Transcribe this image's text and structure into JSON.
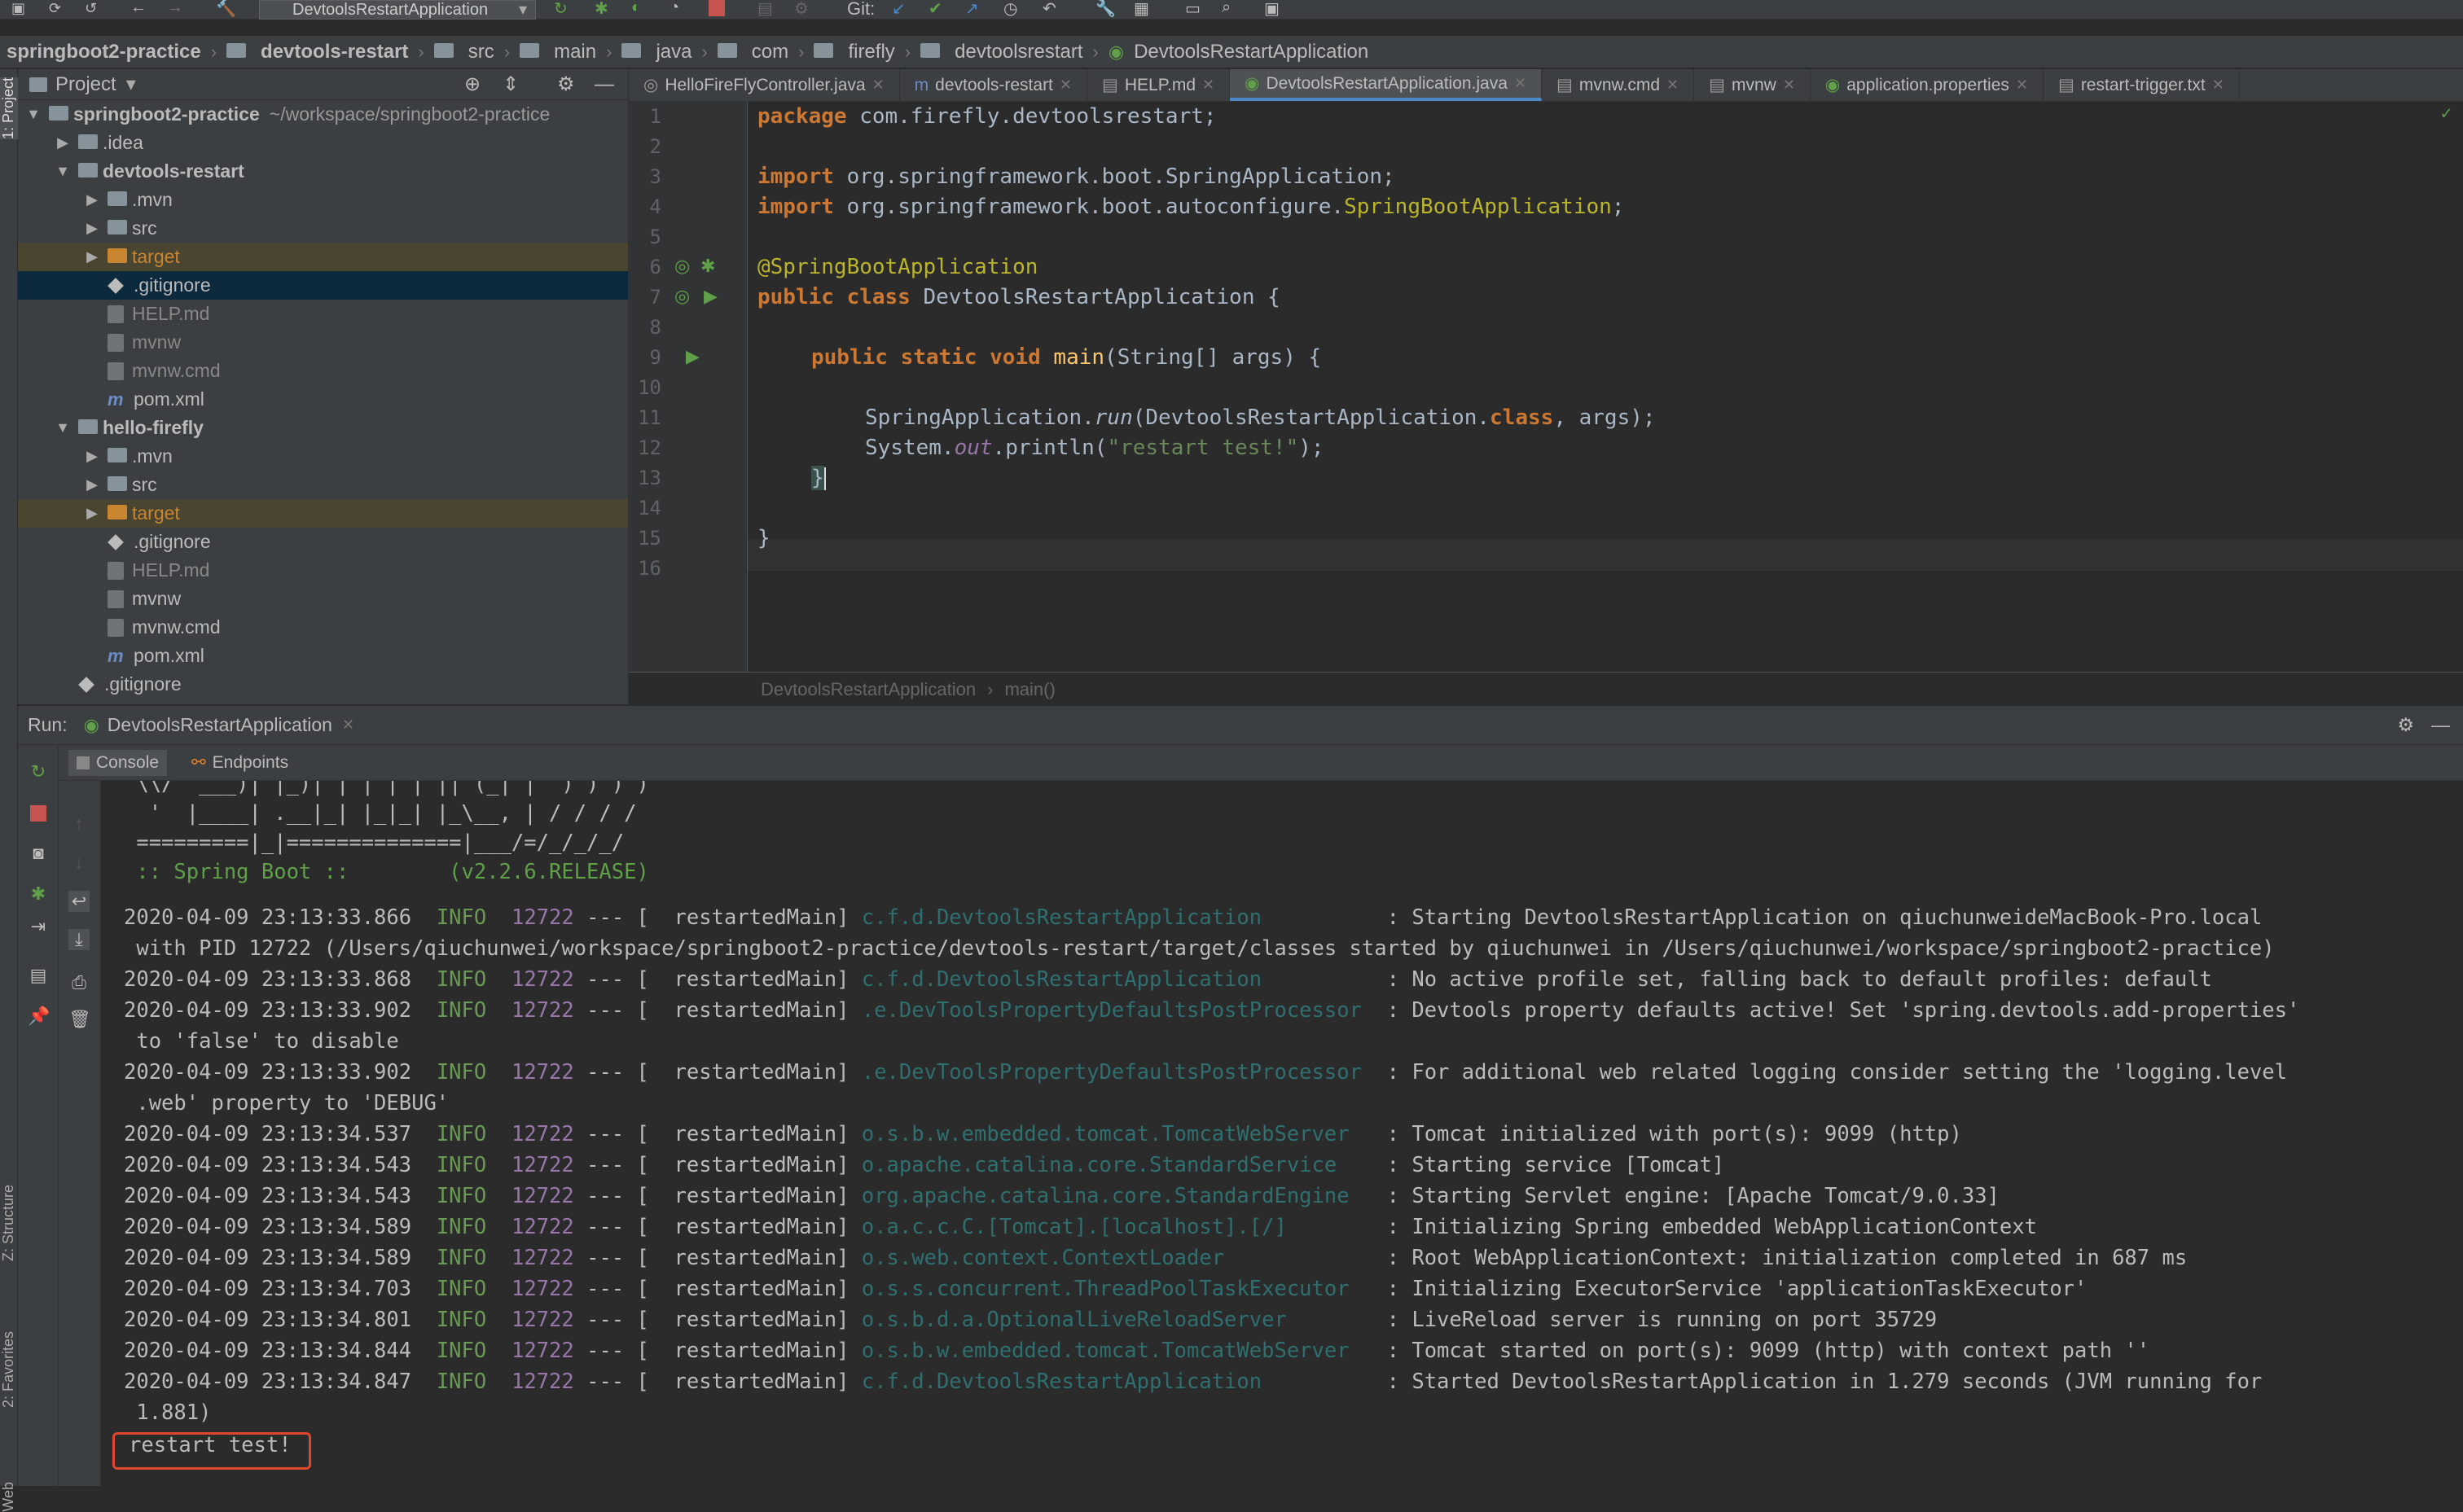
{
  "toolbar": {
    "run_config": "DevtoolsRestartApplication",
    "git_label": "Git:"
  },
  "breadcrumbs": [
    "springboot2-practice",
    "devtools-restart",
    "src",
    "main",
    "java",
    "com",
    "firefly",
    "devtoolsrestart",
    "DevtoolsRestartApplication"
  ],
  "left_strip": {
    "project_tab": "1: Project",
    "structure_tab": "Z: Structure",
    "favorites_tab": "2: Favorites",
    "web_tab": "Web"
  },
  "project": {
    "title": "Project",
    "root_name": "springboot2-practice",
    "root_path": "~/workspace/springboot2-practice",
    "items": [
      {
        "label": ".idea",
        "type": "folder"
      },
      {
        "label": "devtools-restart",
        "type": "folder"
      },
      {
        "label": ".mvn",
        "type": "folder"
      },
      {
        "label": "src",
        "type": "folder"
      },
      {
        "label": "target",
        "type": "folder-orange"
      },
      {
        "label": ".gitignore",
        "type": "git"
      },
      {
        "label": "HELP.md",
        "type": "file"
      },
      {
        "label": "mvnw",
        "type": "file"
      },
      {
        "label": "mvnw.cmd",
        "type": "file"
      },
      {
        "label": "pom.xml",
        "type": "maven"
      },
      {
        "label": "hello-firefly",
        "type": "folder"
      },
      {
        "label": ".mvn",
        "type": "folder"
      },
      {
        "label": "src",
        "type": "folder"
      },
      {
        "label": "target",
        "type": "folder-orange"
      },
      {
        "label": ".gitignore",
        "type": "git"
      },
      {
        "label": "HELP.md",
        "type": "file"
      },
      {
        "label": "mvnw",
        "type": "file"
      },
      {
        "label": "mvnw.cmd",
        "type": "file"
      },
      {
        "label": "pom.xml",
        "type": "maven"
      },
      {
        "label": ".gitignore",
        "type": "git"
      }
    ]
  },
  "editor_tabs": [
    "HelloFireFlyController.java",
    "devtools-restart",
    "HELP.md",
    "DevtoolsRestartApplication.java",
    "mvnw.cmd",
    "mvnw",
    "application.properties",
    "restart-trigger.txt"
  ],
  "code": {
    "line_numbers": [
      "1",
      "2",
      "3",
      "4",
      "5",
      "6",
      "7",
      "8",
      "9",
      "10",
      "11",
      "12",
      "13",
      "14",
      "15",
      "16"
    ],
    "l1_kw": "package",
    "l1_rest": " com.firefly.devtoolsrestart;",
    "l3_kw": "import",
    "l3_rest": " org.springframework.boot.SpringApplication;",
    "l4_kw": "import",
    "l4_pkg": " org.springframework.boot.autoconfigure.",
    "l4_cls": "SpringBootApplication",
    "l4_end": ";",
    "l6_ann": "@SpringBootApplication",
    "l7_kw": "public class",
    "l7_name": " DevtoolsRestartApplication",
    "l7_end": " {",
    "l9_kw": "public static void",
    "l9_mth": " main",
    "l9_args": "(String[] args) {",
    "l11_a": "SpringApplication.",
    "l11_run": "run",
    "l11_b": "(DevtoolsRestartApplication.",
    "l11_cls": "class",
    "l11_c": ", args);",
    "l12_a": "System.",
    "l12_out": "out",
    "l12_b": ".println(",
    "l12_str": "\"restart test!\"",
    "l12_c": ");",
    "l13": "}",
    "l15": "}"
  },
  "editor_breadcrumb": [
    "DevtoolsRestartApplication",
    "main()"
  ],
  "run": {
    "label": "Run:",
    "config": "DevtoolsRestartApplication",
    "tabs": [
      "Console",
      "Endpoints"
    ]
  },
  "console": {
    "banner": [
      " \\\\/  ___)| |_)| | | | | || (_| |  ) ) ) )",
      "  '  |____| .__|_| |_|_| |_\\__, | / / / /",
      " =========|_|==============|___/=/_/_/_/",
      " :: Spring Boot ::        (v2.2.6.RELEASE)"
    ],
    "logs": [
      {
        "ts": "2020-04-09 23:13:33.866",
        "lvl": "INFO",
        "pid": "12722",
        "thread": " --- [  restartedMain] ",
        "logger": "c.f.d.DevtoolsRestartApplication         ",
        "msg": " : Starting DevtoolsRestartApplication on qiuchunweideMacBook-Pro.local"
      },
      {
        "cont": " with PID 12722 (/Users/qiuchunwei/workspace/springboot2-practice/devtools-restart/target/classes started by qiuchunwei in /Users/qiuchunwei/workspace/springboot2-practice)"
      },
      {
        "ts": "2020-04-09 23:13:33.868",
        "lvl": "INFO",
        "pid": "12722",
        "thread": " --- [  restartedMain] ",
        "logger": "c.f.d.DevtoolsRestartApplication         ",
        "msg": " : No active profile set, falling back to default profiles: default"
      },
      {
        "ts": "2020-04-09 23:13:33.902",
        "lvl": "INFO",
        "pid": "12722",
        "thread": " --- [  restartedMain] ",
        "logger": ".e.DevToolsPropertyDefaultsPostProcessor ",
        "msg": " : Devtools property defaults active! Set 'spring.devtools.add-properties'"
      },
      {
        "cont": " to 'false' to disable"
      },
      {
        "ts": "2020-04-09 23:13:33.902",
        "lvl": "INFO",
        "pid": "12722",
        "thread": " --- [  restartedMain] ",
        "logger": ".e.DevToolsPropertyDefaultsPostProcessor ",
        "msg": " : For additional web related logging consider setting the 'logging.level"
      },
      {
        "cont": " .web' property to 'DEBUG'"
      },
      {
        "ts": "2020-04-09 23:13:34.537",
        "lvl": "INFO",
        "pid": "12722",
        "thread": " --- [  restartedMain] ",
        "logger": "o.s.b.w.embedded.tomcat.TomcatWebServer  ",
        "msg": " : Tomcat initialized with port(s): 9099 (http)"
      },
      {
        "ts": "2020-04-09 23:13:34.543",
        "lvl": "INFO",
        "pid": "12722",
        "thread": " --- [  restartedMain] ",
        "logger": "o.apache.catalina.core.StandardService   ",
        "msg": " : Starting service [Tomcat]"
      },
      {
        "ts": "2020-04-09 23:13:34.543",
        "lvl": "INFO",
        "pid": "12722",
        "thread": " --- [  restartedMain] ",
        "logger": "org.apache.catalina.core.StandardEngine  ",
        "msg": " : Starting Servlet engine: [Apache Tomcat/9.0.33]"
      },
      {
        "ts": "2020-04-09 23:13:34.589",
        "lvl": "INFO",
        "pid": "12722",
        "thread": " --- [  restartedMain] ",
        "logger": "o.a.c.c.C.[Tomcat].[localhost].[/]       ",
        "msg": " : Initializing Spring embedded WebApplicationContext"
      },
      {
        "ts": "2020-04-09 23:13:34.589",
        "lvl": "INFO",
        "pid": "12722",
        "thread": " --- [  restartedMain] ",
        "logger": "o.s.web.context.ContextLoader            ",
        "msg": " : Root WebApplicationContext: initialization completed in 687 ms"
      },
      {
        "ts": "2020-04-09 23:13:34.703",
        "lvl": "INFO",
        "pid": "12722",
        "thread": " --- [  restartedMain] ",
        "logger": "o.s.s.concurrent.ThreadPoolTaskExecutor  ",
        "msg": " : Initializing ExecutorService 'applicationTaskExecutor'"
      },
      {
        "ts": "2020-04-09 23:13:34.801",
        "lvl": "INFO",
        "pid": "12722",
        "thread": " --- [  restartedMain] ",
        "logger": "o.s.b.d.a.OptionalLiveReloadServer       ",
        "msg": " : LiveReload server is running on port 35729"
      },
      {
        "ts": "2020-04-09 23:13:34.844",
        "lvl": "INFO",
        "pid": "12722",
        "thread": " --- [  restartedMain] ",
        "logger": "o.s.b.w.embedded.tomcat.TomcatWebServer  ",
        "msg": " : Tomcat started on port(s): 9099 (http) with context path ''"
      },
      {
        "ts": "2020-04-09 23:13:34.847",
        "lvl": "INFO",
        "pid": "12722",
        "thread": " --- [  restartedMain] ",
        "logger": "c.f.d.DevtoolsRestartApplication         ",
        "msg": " : Started DevtoolsRestartApplication in 1.279 seconds (JVM running for"
      },
      {
        "cont": " 1.881)"
      }
    ],
    "final_output": "restart test!"
  },
  "colors": {
    "accent": "#4a88c7",
    "highlight_box": "#e0462e"
  }
}
